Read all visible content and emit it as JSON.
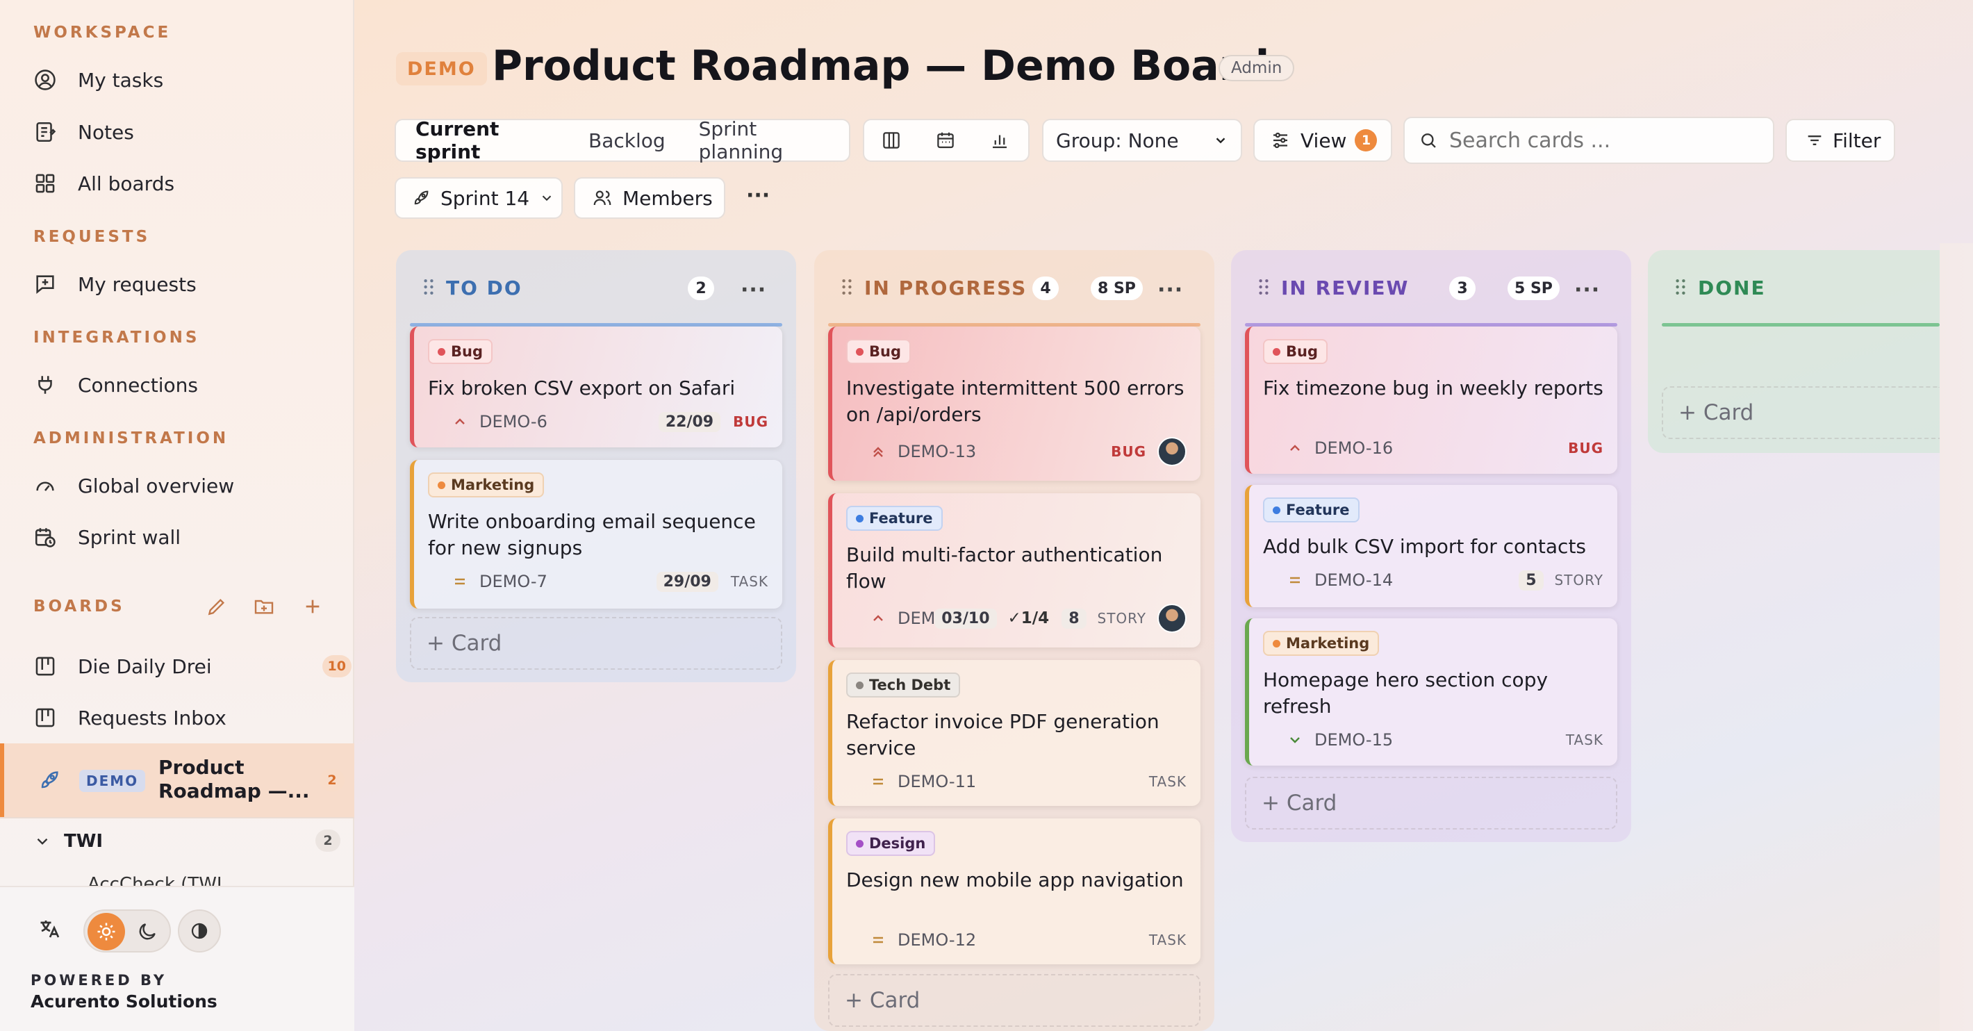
{
  "sidebar": {
    "workspace_label": "WORKSPACE",
    "workspace_items": [
      "My tasks",
      "Notes",
      "All boards"
    ],
    "requests_label": "REQUESTS",
    "requests_items": [
      "My requests"
    ],
    "integrations_label": "INTEGRATIONS",
    "integrations_items": [
      "Connections"
    ],
    "administration_label": "ADMINISTRATION",
    "administration_items": [
      "Global overview",
      "Sprint wall"
    ],
    "boards_label": "BOARDS",
    "boards": [
      {
        "name": "Die Daily Drei",
        "count": "10"
      },
      {
        "name": "Requests Inbox",
        "count": ""
      },
      {
        "prefix": "DEMO",
        "name": "Product",
        "name2": "Roadmap —...",
        "count": "2"
      }
    ],
    "group": {
      "name": "TWI",
      "count": "2",
      "partial_item": "AccCheck (TWI"
    },
    "powered_by": "POWERED BY",
    "company": "Acurento Solutions"
  },
  "header": {
    "badge": "DEMO",
    "title": "Product Roadmap — Demo Board",
    "role": "Admin"
  },
  "toolbar": {
    "tabs": [
      "Current sprint",
      "Backlog",
      "Sprint planning"
    ],
    "group_select": "Group: None",
    "view_label": "View",
    "view_count": "1",
    "search_placeholder": "Search cards ...",
    "filter_label": "Filter",
    "sprint_label": "Sprint 14",
    "members_label": "Members",
    "more": "···"
  },
  "columns": [
    {
      "name": "TO DO",
      "count": "2",
      "sp": "",
      "color": "#3d6fb0",
      "cards": [
        {
          "tag": "Bug",
          "title": "Fix broken CSV export on Safari",
          "key": "DEMO-6",
          "date": "22/09",
          "type": "BUG"
        },
        {
          "tag": "Marketing",
          "title": "Write onboarding email sequence for new signups",
          "key": "DEMO-7",
          "date": "29/09",
          "type": "TASK"
        }
      ],
      "add": "+ Card"
    },
    {
      "name": "IN PROGRESS",
      "count": "4",
      "sp": "8 SP",
      "color": "#b0683d",
      "cards": [
        {
          "tag": "Bug",
          "title": "Investigate intermittent 500 errors on /api/orders",
          "key": "DEMO-13",
          "type": "BUG"
        },
        {
          "tag": "Feature",
          "title": "Build multi-factor authentication flow",
          "key": "DEMO-10",
          "date": "03/10",
          "checklist": "✓1/4",
          "points": "8",
          "type": "STORY"
        },
        {
          "tag": "Tech Debt",
          "title": "Refactor invoice PDF generation service",
          "key": "DEMO-11",
          "type": "TASK"
        },
        {
          "tag": "Design",
          "title": "Design new mobile app navigation",
          "key": "DEMO-12",
          "type": "TASK"
        }
      ],
      "add": "+ Card"
    },
    {
      "name": "IN REVIEW",
      "count": "3",
      "sp": "5 SP",
      "color": "#6a4ab0",
      "cards": [
        {
          "tag": "Bug",
          "title": "Fix timezone bug in weekly reports",
          "key": "DEMO-16",
          "type": "BUG"
        },
        {
          "tag": "Feature",
          "title": "Add bulk CSV import for contacts",
          "key": "DEMO-14",
          "points": "5",
          "type": "STORY"
        },
        {
          "tag": "Marketing",
          "title": "Homepage hero section copy refresh",
          "key": "DEMO-15",
          "type": "TASK"
        }
      ],
      "add": "+ Card"
    },
    {
      "name": "DONE",
      "count": "",
      "sp": "",
      "color": "#2f8a55",
      "cards": [],
      "add": "+ Card"
    }
  ]
}
